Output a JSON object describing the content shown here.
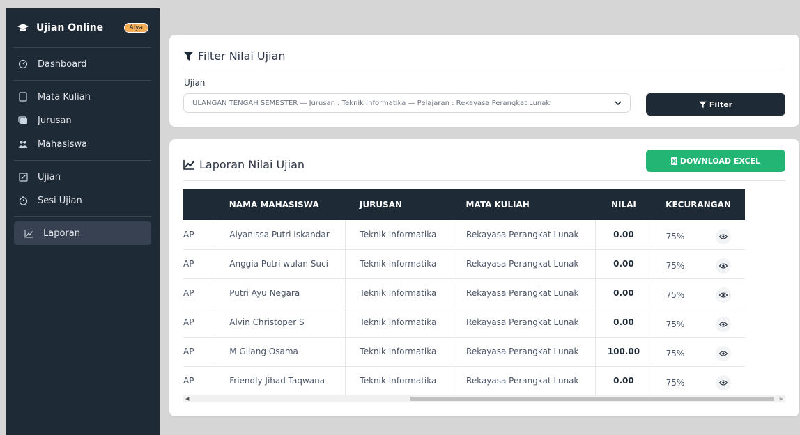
{
  "app": {
    "title": "Ujian Online",
    "user_badge": "Alya"
  },
  "sidebar": {
    "items": [
      {
        "label": "Dashboard",
        "icon": "gauge-icon"
      },
      {
        "label": "Mata Kuliah",
        "icon": "book-icon"
      },
      {
        "label": "Jurusan",
        "icon": "folder-icon"
      },
      {
        "label": "Mahasiswa",
        "icon": "users-icon"
      },
      {
        "label": "Ujian",
        "icon": "edit-icon"
      },
      {
        "label": "Sesi Ujian",
        "icon": "clock-icon"
      },
      {
        "label": "Laporan",
        "icon": "chart-line-icon",
        "active": true
      }
    ]
  },
  "filter": {
    "title": "Filter Nilai Ujian",
    "field_label": "Ujian",
    "selected": "ULANGAN TENGAH SEMESTER — Jurusan : Teknik Informatika — Pelajaran : Rekayasa Perangkat Lunak",
    "button": "Filter"
  },
  "report": {
    "title": "Laporan Nilai Ujian",
    "download_button": "DOWNLOAD EXCEL",
    "columns": [
      "NAMA MAHASISWA",
      "JURUSAN",
      "MATA KULIAH",
      "NILAI",
      "KECURANGAN"
    ],
    "rows": [
      {
        "sesi": "R GENAP",
        "nama": "Alyanissa Putri Iskandar",
        "jurusan": "Teknik Informatika",
        "mata_kuliah": "Rekayasa Perangkat Lunak",
        "nilai": "0.00",
        "kecurangan": "75%"
      },
      {
        "sesi": "R GENAP",
        "nama": "Anggia Putri wulan Suci",
        "jurusan": "Teknik Informatika",
        "mata_kuliah": "Rekayasa Perangkat Lunak",
        "nilai": "0.00",
        "kecurangan": "75%"
      },
      {
        "sesi": "R GENAP",
        "nama": "Putri Ayu Negara",
        "jurusan": "Teknik Informatika",
        "mata_kuliah": "Rekayasa Perangkat Lunak",
        "nilai": "0.00",
        "kecurangan": "75%"
      },
      {
        "sesi": "R GENAP",
        "nama": "Alvin Christoper S",
        "jurusan": "Teknik Informatika",
        "mata_kuliah": "Rekayasa Perangkat Lunak",
        "nilai": "0.00",
        "kecurangan": "75%"
      },
      {
        "sesi": "R GENAP",
        "nama": "M Gilang Osama",
        "jurusan": "Teknik Informatika",
        "mata_kuliah": "Rekayasa Perangkat Lunak",
        "nilai": "100.00",
        "kecurangan": "75%"
      },
      {
        "sesi": "R GENAP",
        "nama": "Friendly Jihad Taqwana",
        "jurusan": "Teknik Informatika",
        "mata_kuliah": "Rekayasa Perangkat Lunak",
        "nilai": "0.00",
        "kecurangan": "75%"
      }
    ]
  },
  "colors": {
    "sidebar_bg": "#1f2a37",
    "primary_dark": "#1f2a37",
    "excel_green": "#22b573",
    "badge": "#f6ad55"
  }
}
